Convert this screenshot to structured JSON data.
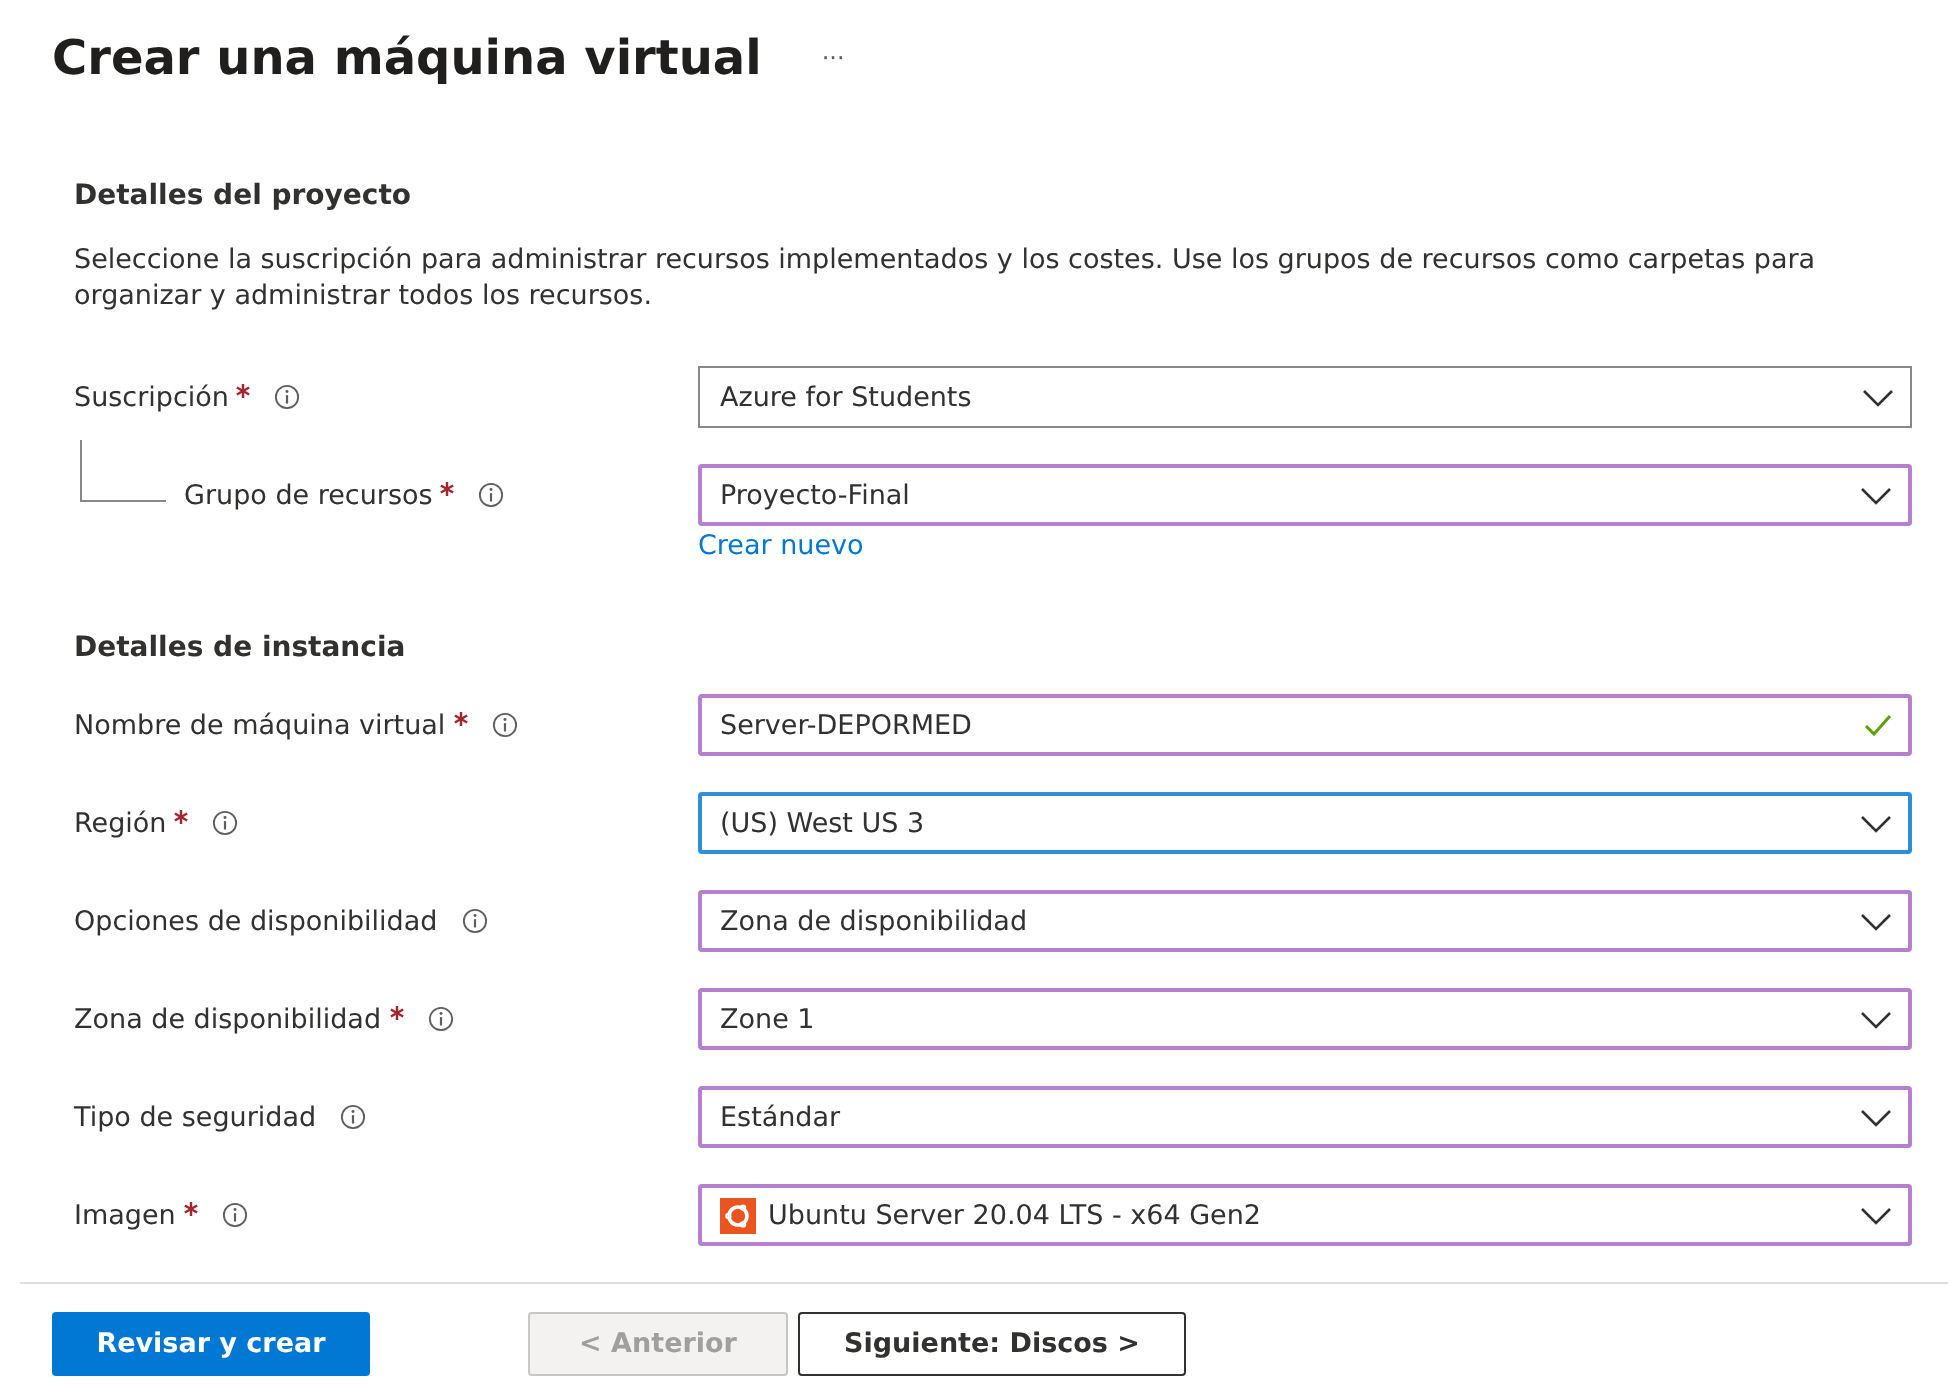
{
  "page": {
    "title": "Crear una máquina virtual",
    "more": "···"
  },
  "sections": [
    {
      "heading": "Detalles del proyecto",
      "description": "Seleccione la suscripción para administrar recursos implementados y los costes. Use los grupos de recursos como carpetas para organizar y administrar todos los recursos.",
      "fields": [
        {
          "label": "Suscripción",
          "required": true,
          "kind": "select",
          "modified": false,
          "focused": false,
          "value": "Azure for Students",
          "valid": false,
          "children": [
            {
              "label": "Grupo de recursos",
              "required": true,
              "kind": "select",
              "modified": true,
              "focused": false,
              "value": "Proyecto-Final",
              "valid": false,
              "link": "Crear nuevo"
            }
          ]
        }
      ]
    },
    {
      "heading": "Detalles de instancia",
      "fields": [
        {
          "label": "Nombre de máquina virtual",
          "required": true,
          "kind": "text",
          "modified": true,
          "focused": false,
          "value": "Server-DEPORMED",
          "valid": true
        },
        {
          "label": "Región",
          "required": true,
          "kind": "select",
          "modified": true,
          "focused": true,
          "value": "(US) West US 3",
          "valid": false
        },
        {
          "label": "Opciones de disponibilidad",
          "required": false,
          "kind": "select",
          "modified": true,
          "focused": false,
          "value": "Zona de disponibilidad",
          "valid": false
        },
        {
          "label": "Zona de disponibilidad",
          "required": true,
          "kind": "select",
          "modified": true,
          "focused": false,
          "value": "Zone 1",
          "valid": false
        },
        {
          "label": "Tipo de seguridad",
          "required": false,
          "kind": "select",
          "modified": true,
          "focused": false,
          "value": "Estándar",
          "valid": false
        },
        {
          "label": "Imagen",
          "required": true,
          "kind": "image-select",
          "modified": true,
          "focused": false,
          "value": "Ubuntu Server 20.04 LTS - x64 Gen2",
          "valid": false
        }
      ]
    }
  ],
  "footer": {
    "buttons": [
      {
        "label": "Revisar y crear",
        "kind": "primary",
        "disabled": false
      },
      {
        "label": "< Anterior",
        "kind": "secondary",
        "disabled": true
      },
      {
        "label": "Siguiente: Discos >",
        "kind": "secondary",
        "disabled": false
      }
    ]
  }
}
